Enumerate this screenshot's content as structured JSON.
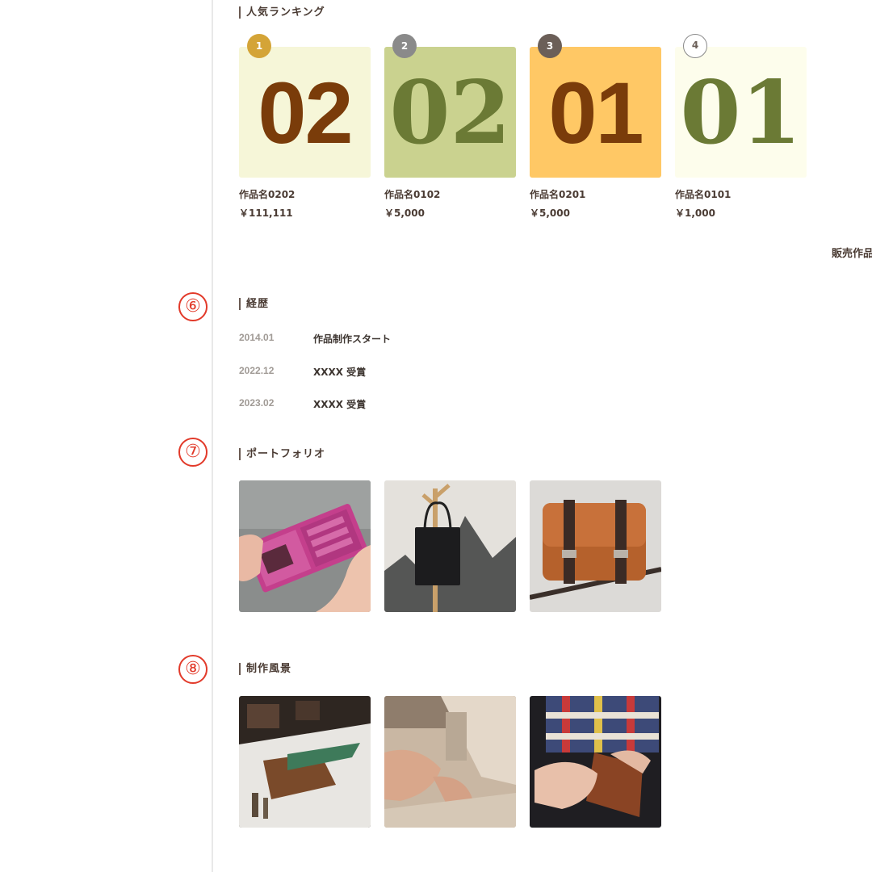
{
  "ranking": {
    "title": "人気ランキング",
    "items": [
      {
        "rank": "1",
        "number": "02",
        "name": "作品名0202",
        "price": "￥111,111"
      },
      {
        "rank": "2",
        "number": "02",
        "name": "作品名0102",
        "price": "￥5,000"
      },
      {
        "rank": "3",
        "number": "01",
        "name": "作品名0201",
        "price": "￥5,000"
      },
      {
        "rank": "4",
        "number": "01",
        "name": "作品名0101",
        "price": "￥1,000"
      }
    ],
    "more_link": "販売作品"
  },
  "career": {
    "marker": "⑥",
    "title": "経歴",
    "entries": [
      {
        "date": "2014.01",
        "text": "作品制作スタート"
      },
      {
        "date": "2022.12",
        "text": "XXXX 受賞"
      },
      {
        "date": "2023.02",
        "text": "XXXX 受賞"
      }
    ]
  },
  "portfolio": {
    "marker": "⑦",
    "title": "ポートフォリオ",
    "images": [
      "pink-leather-wallet",
      "black-tote-bag-on-coat-rack",
      "brown-leather-messenger-bag"
    ]
  },
  "workshop": {
    "marker": "⑧",
    "title": "制作風景",
    "images": [
      "leather-cutting-workbench",
      "sewing-machine-stitching",
      "hand-stitching-leather"
    ]
  },
  "colors": {
    "badge_gold": "#d4a437",
    "badge_gray": "#8a8a8a",
    "badge_dark": "#6b5f58",
    "marker_red": "#e23a2a",
    "tile1": "#f6f6d8",
    "tile2": "#cad28f",
    "tile3": "#ffc865",
    "tile4": "#fdfdec",
    "number_brown": "#7a3c0a",
    "number_olive": "#6b7a35"
  }
}
